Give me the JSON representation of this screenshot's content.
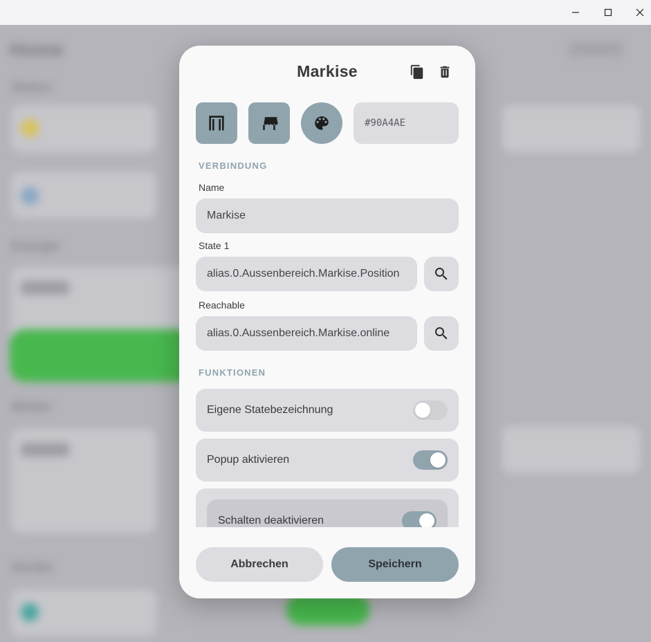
{
  "window": {
    "controls": [
      "minimize",
      "maximize",
      "close"
    ]
  },
  "background": {
    "title": "Home",
    "sections": [
      "Status",
      "Energie",
      "Wetter",
      "Geräte"
    ]
  },
  "dialog": {
    "title": "Markise",
    "icons": {
      "copy": "copy-icon",
      "delete": "trash-icon",
      "tile1": "door-frame-icon",
      "tile2": "awning-icon",
      "tile3": "palette-icon"
    },
    "color_value": "#90A4AE",
    "accent_color": "#90a4ae",
    "section_connection": "VERBINDUNG",
    "name_label": "Name",
    "name_value": "Markise",
    "state1_label": "State 1",
    "state1_value": "alias.0.Aussenbereich.Markise.Position",
    "reachable_label": "Reachable",
    "reachable_value": "alias.0.Aussenbereich.Markise.online",
    "section_functions": "FUNKTIONEN",
    "toggles": [
      {
        "label": "Eigene Statebezeichnung",
        "on": false
      },
      {
        "label": "Popup aktivieren",
        "on": true
      },
      {
        "label": "Schalten deaktivieren",
        "on": true
      }
    ],
    "cancel_label": "Abbrechen",
    "save_label": "Speichern"
  }
}
